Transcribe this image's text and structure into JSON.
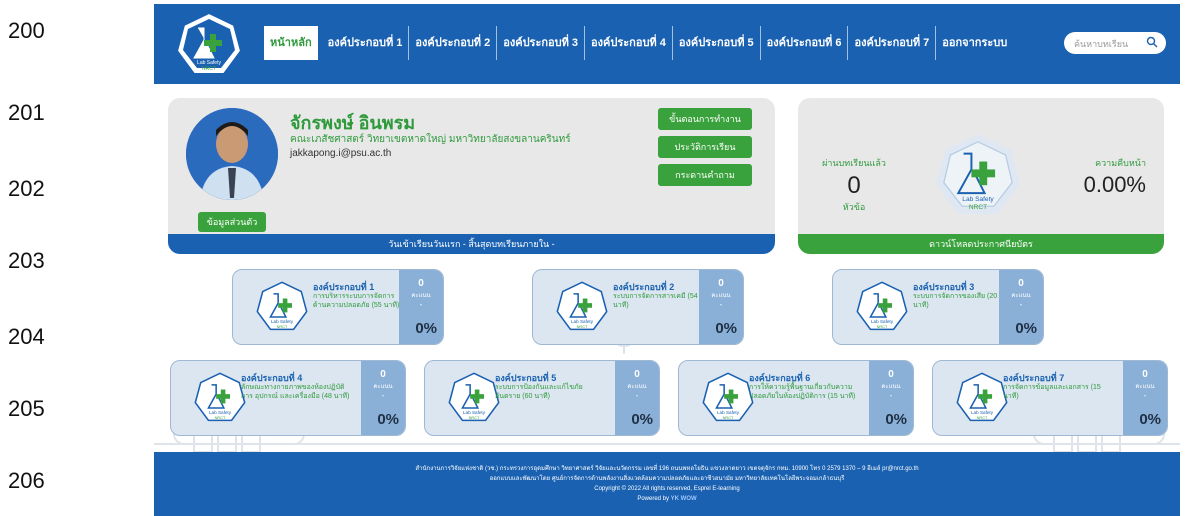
{
  "line_numbers": [
    "200",
    "201",
    "202",
    "203",
    "204",
    "205",
    "206"
  ],
  "logo": {
    "text1": "Lab Safety",
    "text2": "NRCT"
  },
  "nav": {
    "items": [
      {
        "label": "หน้าหลัก",
        "active": true
      },
      {
        "label": "องค์ประกอบที่ 1"
      },
      {
        "label": "องค์ประกอบที่ 2"
      },
      {
        "label": "องค์ประกอบที่ 3"
      },
      {
        "label": "องค์ประกอบที่ 4"
      },
      {
        "label": "องค์ประกอบที่ 5"
      },
      {
        "label": "องค์ประกอบที่ 6"
      },
      {
        "label": "องค์ประกอบที่ 7"
      },
      {
        "label": "ออกจากระบบ"
      }
    ],
    "search_placeholder": "ค้นหาบทเรียน"
  },
  "profile": {
    "name": "จักรพงษ์ อินพรม",
    "faculty": "คณะเภสัชศาสตร์ วิทยาเขตหาดใหญ่ มหาวิทยาลัยสงขลานครินทร์",
    "email": "jakkapong.i@psu.ac.th",
    "personal_button": "ข้อมูลส่วนตัว",
    "steps_button": "ขั้นตอนการทำงาน",
    "history_button": "ประวัติการเรียน",
    "board_button": "กระดานคำถาม",
    "bar_text": "วันเข้าเรียนวันแรก - สิ้นสุดบทเรียนภายใน -"
  },
  "progress": {
    "passed_label": "ผ่านบทเรียนแล้ว",
    "passed_value": "0",
    "passed_unit": "หัวข้อ",
    "progress_label": "ความคืบหน้า",
    "progress_value": "0.00%",
    "download_bar": "ดาวน์โหลดประกาศนียบัตร"
  },
  "modules": [
    {
      "title": "องค์ประกอบที่ 1",
      "subtitle": "การบริหารระบบการจัดการด้านความปลอดภัย (55 นาที)",
      "score": "0",
      "score_label": "คะแนน",
      "dash": "-",
      "percent": "0%"
    },
    {
      "title": "องค์ประกอบที่ 2",
      "subtitle": "ระบบการจัดการสารเคมี (54 นาที)",
      "score": "0",
      "score_label": "คะแนน",
      "dash": "-",
      "percent": "0%"
    },
    {
      "title": "องค์ประกอบที่ 3",
      "subtitle": "ระบบการจัดการของเสีย (20 นาที)",
      "score": "0",
      "score_label": "คะแนน",
      "dash": "-",
      "percent": "0%"
    },
    {
      "title": "องค์ประกอบที่ 4",
      "subtitle": "ลักษณะทางกายภาพของห้องปฏิบัติการ อุปกรณ์ และเครื่องมือ (48 นาที)",
      "score": "0",
      "score_label": "คะแนน",
      "dash": "-",
      "percent": "0%"
    },
    {
      "title": "องค์ประกอบที่ 5",
      "subtitle": "ระบบการป้องกันและแก้ไขภัยอันตราย (60 นาที)",
      "score": "0",
      "score_label": "คะแนน",
      "dash": "-",
      "percent": "0%"
    },
    {
      "title": "องค์ประกอบที่ 6",
      "subtitle": "การให้ความรู้พื้นฐานเกี่ยวกับความปลอดภัยในห้องปฏิบัติการ (15 นาที)",
      "score": "0",
      "score_label": "คะแนน",
      "dash": "-",
      "percent": "0%"
    },
    {
      "title": "องค์ประกอบที่ 7",
      "subtitle": "การจัดการข้อมูลและเอกสาร (15 นาที)",
      "score": "0",
      "score_label": "คะแนน",
      "dash": "-",
      "percent": "0%"
    }
  ],
  "footer": {
    "line1": "สำนักงานการวิจัยแห่งชาติ (วช.) กระทรวงการอุดมศึกษา วิทยาศาสตร์ วิจัยและนวัตกรรม เลขที่ 196 ถนนพหลโยธิน แขวงลาดยาว เขตจตุจักร กทม. 10900 โทร 0 2579 1370 – 9 อีเมล์ pr@nrct.go.th",
    "line2": "ออกแบบและพัฒนาโดย ศูนย์การจัดการด้านพลังงานสิ่งแวดล้อมความปลอดภัยและอาชีวอนามัย มหาวิทยาลัยเทคโนโลยีพระจอมเกล้าธนบุรี",
    "line3": "Copyright © 2022 All rights reserved, Esprel E-learning",
    "powered": "Powered by",
    "brand": "YK WOW"
  },
  "colors": {
    "primary_blue": "#1a61b1",
    "green": "#3aa23c",
    "card_gray": "#e8e8e8",
    "module_bg": "#dce6f0",
    "module_side": "#8ab0d8"
  }
}
